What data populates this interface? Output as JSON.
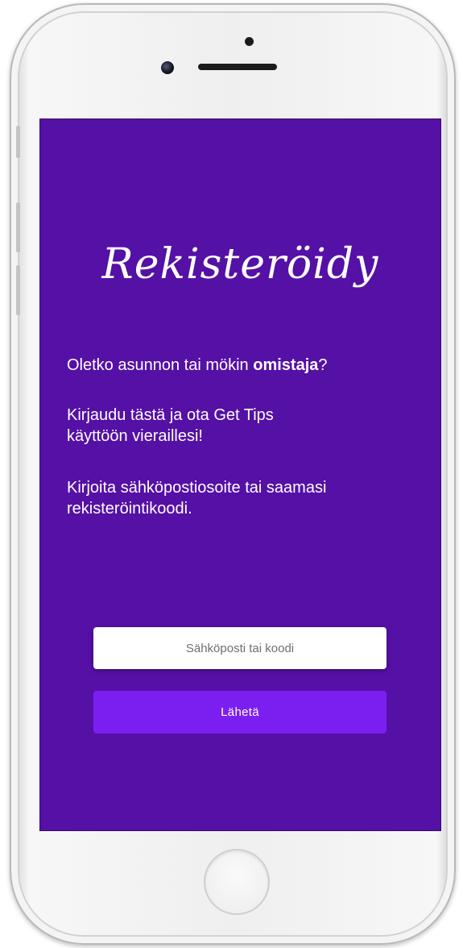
{
  "screen": {
    "title": "Rekisteröidy",
    "line1_prefix": "Oletko asunnon tai mökin ",
    "line1_bold": "omistaja",
    "line1_suffix": "?",
    "paragraph2_line1": "Kirjaudu tästä ja ota Get Tips",
    "paragraph2_line2": "käyttöön vieraillesi!",
    "paragraph3_line1": "Kirjoita sähköpostiosoite tai saamasi",
    "paragraph3_line2": "rekisteröintikoodi.",
    "input": {
      "placeholder": "Sähköposti tai koodi",
      "value": ""
    },
    "submit_label": "Lähetä"
  },
  "colors": {
    "background": "#5510a6",
    "button": "#7b1ff0",
    "text": "#ffffff"
  }
}
